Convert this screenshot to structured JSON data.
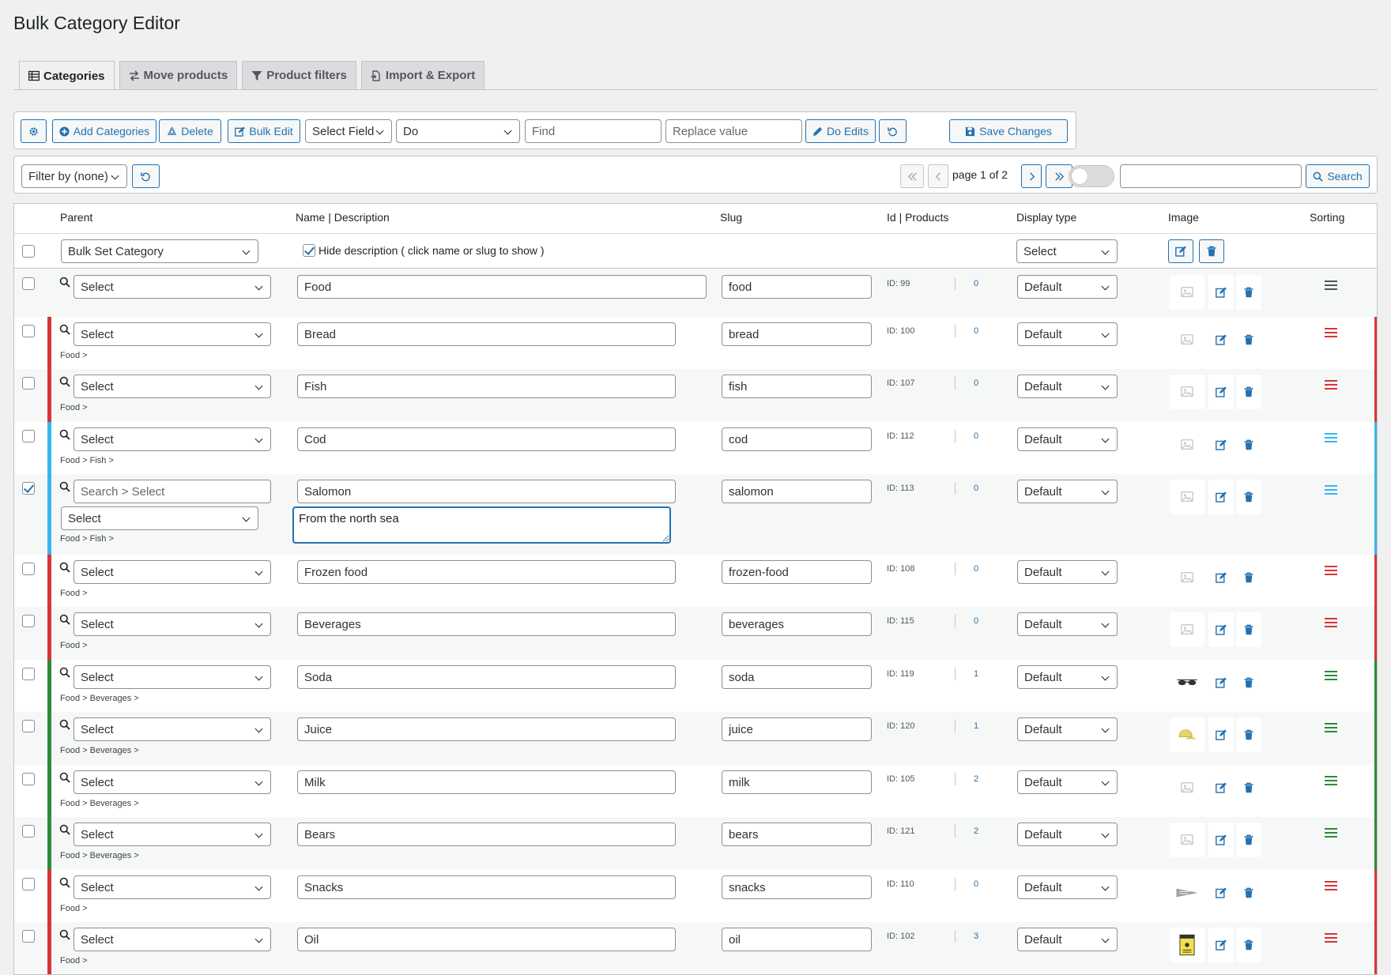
{
  "page": {
    "title": "Bulk Category Editor"
  },
  "tabs": [
    {
      "label": "Categories",
      "icon": "table-icon",
      "active": true
    },
    {
      "label": "Move products",
      "icon": "arrows-icon",
      "active": false
    },
    {
      "label": "Product filters",
      "icon": "filter-icon",
      "active": false
    },
    {
      "label": "Import & Export",
      "icon": "file-export-icon",
      "active": false
    }
  ],
  "toolbar": {
    "add_label": "Add Categories",
    "delete_label": "Delete",
    "bulk_edit_label": "Bulk Edit",
    "select_field_value": "Select Field",
    "do_value": "Do",
    "find_placeholder": "Find",
    "replace_placeholder": "Replace value",
    "do_edits_label": "Do Edits",
    "save_label": "Save Changes"
  },
  "filterbar": {
    "filter_value": "Filter by (none)",
    "page_label": "page 1 of 2",
    "search_label": "Search",
    "search_value": ""
  },
  "table": {
    "headers": {
      "parent": "Parent",
      "name": "Name | Description",
      "slug": "Slug",
      "id_products": "Id | Products",
      "display": "Display type",
      "image": "Image",
      "sorting": "Sorting"
    },
    "bulk": {
      "set_category": "Bulk Set Category",
      "hide_description": "Hide description ( click name or slug to show )",
      "display_select": "Select"
    },
    "rows": [
      {
        "parent": "Select",
        "path": "",
        "name": "Food",
        "slug": "food",
        "id": "ID: 99",
        "count": "0",
        "display": "Default",
        "bar": "",
        "sort_color": "#50575e",
        "thumb": "placeholder",
        "checked": false
      },
      {
        "parent": "Select",
        "path": "Food >",
        "name": "Bread",
        "slug": "bread",
        "id": "ID: 100",
        "count": "0",
        "display": "Default",
        "bar": "#d63638",
        "sort_color": "#d63638",
        "thumb": "placeholder",
        "checked": false
      },
      {
        "parent": "Select",
        "path": "Food >",
        "name": "Fish",
        "slug": "fish",
        "id": "ID: 107",
        "count": "0",
        "display": "Default",
        "bar": "#d63638",
        "sort_color": "#d63638",
        "thumb": "placeholder",
        "checked": false
      },
      {
        "parent": "Select",
        "path": "Food > Fish >",
        "name": "Cod",
        "slug": "cod",
        "id": "ID: 112",
        "count": "0",
        "display": "Default",
        "bar": "#36b6f0",
        "sort_color": "#36b6f0",
        "thumb": "placeholder",
        "checked": false
      },
      {
        "parent": "Select",
        "search_placeholder": "Search > Select",
        "path": "Food > Fish >",
        "name": "Salomon",
        "slug": "salomon",
        "description": "From the north sea",
        "id": "ID: 113",
        "count": "0",
        "display": "Default",
        "bar": "#36b6f0",
        "sort_color": "#36b6f0",
        "thumb": "placeholder",
        "checked": true
      },
      {
        "parent": "Select",
        "path": "Food >",
        "name": "Frozen food",
        "slug": "frozen-food",
        "id": "ID: 108",
        "count": "0",
        "display": "Default",
        "bar": "#d63638",
        "sort_color": "#d63638",
        "thumb": "placeholder",
        "checked": false
      },
      {
        "parent": "Select",
        "path": "Food >",
        "name": "Beverages",
        "slug": "beverages",
        "id": "ID: 115",
        "count": "0",
        "display": "Default",
        "bar": "#d63638",
        "sort_color": "#d63638",
        "thumb": "placeholder",
        "checked": false
      },
      {
        "parent": "Select",
        "path": "Food > Beverages >",
        "name": "Soda",
        "slug": "soda",
        "id": "ID: 119",
        "count": "1",
        "display": "Default",
        "bar": "#2e8b3a",
        "sort_color": "#2e8b3a",
        "thumb": "sunglasses-icon",
        "checked": false
      },
      {
        "parent": "Select",
        "path": "Food > Beverages >",
        "name": "Juice",
        "slug": "juice",
        "id": "ID: 120",
        "count": "1",
        "display": "Default",
        "bar": "#2e8b3a",
        "sort_color": "#2e8b3a",
        "thumb": "cap-icon",
        "checked": false
      },
      {
        "parent": "Select",
        "path": "Food > Beverages >",
        "name": "Milk",
        "slug": "milk",
        "id": "ID: 105",
        "count": "2",
        "display": "Default",
        "bar": "#2e8b3a",
        "sort_color": "#2e8b3a",
        "thumb": "placeholder",
        "checked": false
      },
      {
        "parent": "Select",
        "path": "Food > Beverages >",
        "name": "Bears",
        "slug": "bears",
        "id": "ID: 121",
        "count": "2",
        "display": "Default",
        "bar": "#2e8b3a",
        "sort_color": "#2e8b3a",
        "thumb": "placeholder",
        "checked": false
      },
      {
        "parent": "Select",
        "path": "Food >",
        "name": "Snacks",
        "slug": "snacks",
        "id": "ID: 110",
        "count": "0",
        "display": "Default",
        "bar": "#d63638",
        "sort_color": "#d63638",
        "thumb": "pennant-icon",
        "checked": false
      },
      {
        "parent": "Select",
        "path": "Food >",
        "name": "Oil",
        "slug": "oil",
        "id": "ID: 102",
        "count": "3",
        "display": "Default",
        "bar": "#d63638",
        "sort_color": "#d63638",
        "thumb": "poster-icon",
        "checked": false
      }
    ]
  },
  "colors": {
    "accent": "#2271b1",
    "red": "#d63638",
    "blue": "#36b6f0",
    "green": "#2e8b3a"
  }
}
